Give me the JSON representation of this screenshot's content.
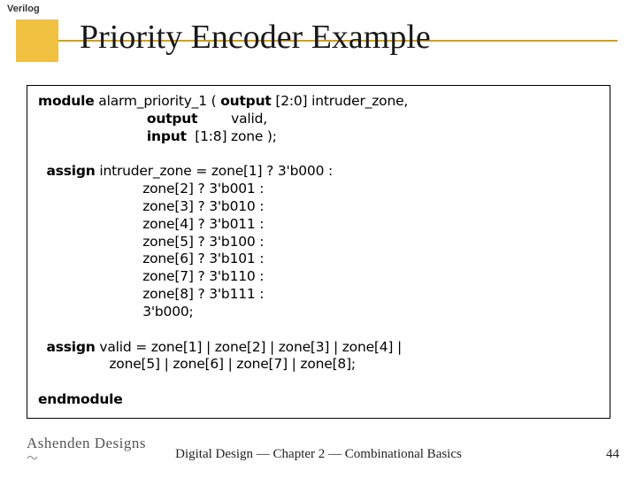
{
  "top_label": "Verilog",
  "title": "Priority Encoder Example",
  "code": {
    "kw_module": "module",
    "mod_name": " alarm_priority_1 ( ",
    "kw_output1": "output",
    "out1_rest": " [2:0] intruder_zone,",
    "pad_out2": "                          ",
    "kw_output2": "output",
    "out2_rest": "        valid,",
    "pad_in": "                          ",
    "kw_input": "input",
    "in_rest": "  [1:8] zone );",
    "kw_assign1": "assign",
    "a1_head": " intruder_zone = zone[1] ? 3'b000 :",
    "a1_pad": "                         ",
    "a1_l2": "zone[2] ? 3'b001 :",
    "a1_l3": "zone[3] ? 3'b010 :",
    "a1_l4": "zone[4] ? 3'b011 :",
    "a1_l5": "zone[5] ? 3'b100 :",
    "a1_l6": "zone[6] ? 3'b101 :",
    "a1_l7": "zone[7] ? 3'b110 :",
    "a1_l8": "zone[8] ? 3'b111 :",
    "a1_l9": "3'b000;",
    "kw_assign2": "assign",
    "a2_l1": " valid = zone[1] | zone[2] | zone[3] | zone[4] |",
    "a2_pad": "                 ",
    "a2_l2": "zone[5] | zone[6] | zone[7] | zone[8];",
    "kw_endmodule": "endmodule"
  },
  "footer": {
    "brand": "Ashenden Designs",
    "center": "Digital Design — Chapter 2 — Combinational Basics",
    "page": "44"
  }
}
